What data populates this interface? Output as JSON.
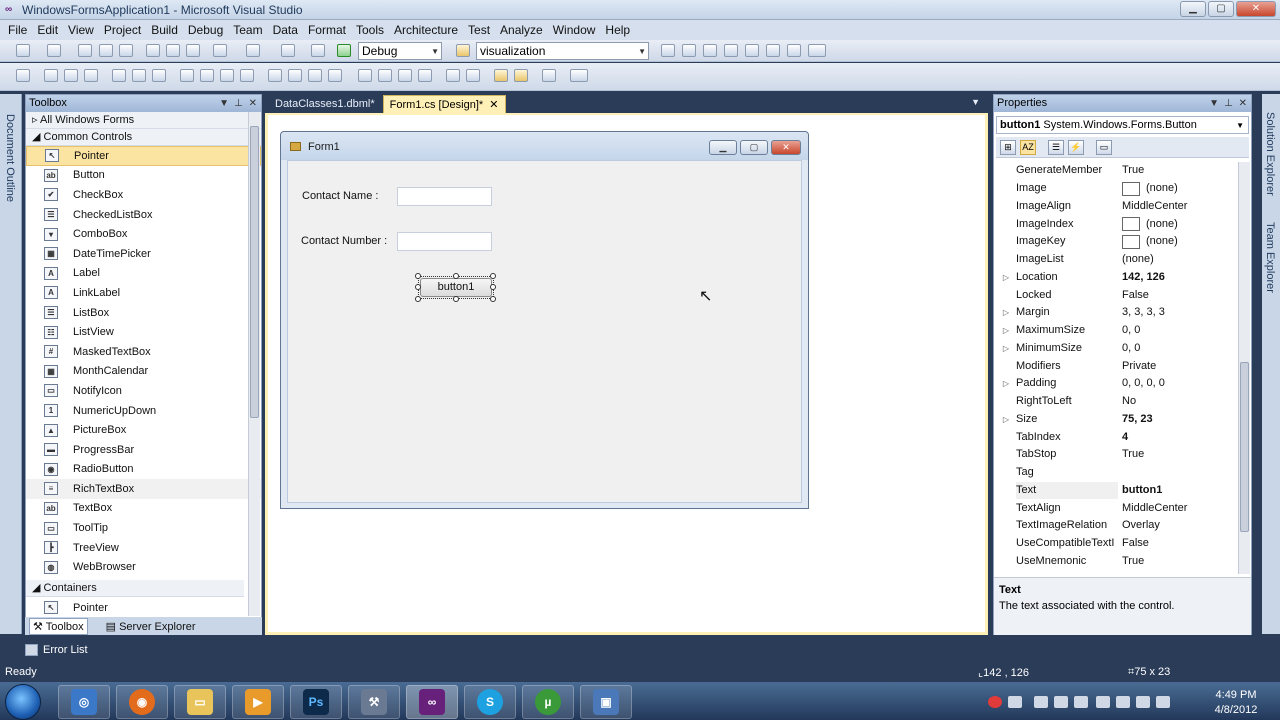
{
  "window": {
    "title": "WindowsFormsApplication1 - Microsoft Visual Studio",
    "vs_icon": "vs-logo-icon"
  },
  "menu": [
    "File",
    "Edit",
    "View",
    "Project",
    "Build",
    "Debug",
    "Team",
    "Data",
    "Format",
    "Tools",
    "Architecture",
    "Test",
    "Analyze",
    "Window",
    "Help"
  ],
  "toolbar": {
    "config": "Debug",
    "find": "visualization"
  },
  "left_strip": {
    "label": "Document Outline"
  },
  "toolbox": {
    "title": "Toolbox",
    "groups": {
      "all": "All Windows Forms",
      "common": "Common Controls",
      "containers": "Containers"
    },
    "items": [
      {
        "label": "Pointer",
        "icon": "pointer-icon",
        "glyph": "↖"
      },
      {
        "label": "Button",
        "icon": "button-icon",
        "glyph": "ab"
      },
      {
        "label": "CheckBox",
        "icon": "checkbox-icon",
        "glyph": "✔"
      },
      {
        "label": "CheckedListBox",
        "icon": "checkedlistbox-icon",
        "glyph": "☰"
      },
      {
        "label": "ComboBox",
        "icon": "combobox-icon",
        "glyph": "▾"
      },
      {
        "label": "DateTimePicker",
        "icon": "datetimepicker-icon",
        "glyph": "▦"
      },
      {
        "label": "Label",
        "icon": "label-icon",
        "glyph": "A"
      },
      {
        "label": "LinkLabel",
        "icon": "linklabel-icon",
        "glyph": "A"
      },
      {
        "label": "ListBox",
        "icon": "listbox-icon",
        "glyph": "☰"
      },
      {
        "label": "ListView",
        "icon": "listview-icon",
        "glyph": "☷"
      },
      {
        "label": "MaskedTextBox",
        "icon": "maskedtextbox-icon",
        "glyph": "#"
      },
      {
        "label": "MonthCalendar",
        "icon": "monthcalendar-icon",
        "glyph": "▦"
      },
      {
        "label": "NotifyIcon",
        "icon": "notifyicon-icon",
        "glyph": "▭"
      },
      {
        "label": "NumericUpDown",
        "icon": "numericupdown-icon",
        "glyph": "1"
      },
      {
        "label": "PictureBox",
        "icon": "picturebox-icon",
        "glyph": "▲"
      },
      {
        "label": "ProgressBar",
        "icon": "progressbar-icon",
        "glyph": "▬"
      },
      {
        "label": "RadioButton",
        "icon": "radiobutton-icon",
        "glyph": "◉"
      },
      {
        "label": "RichTextBox",
        "icon": "richtextbox-icon",
        "glyph": "≡"
      },
      {
        "label": "TextBox",
        "icon": "textbox-icon",
        "glyph": "ab"
      },
      {
        "label": "ToolTip",
        "icon": "tooltip-icon",
        "glyph": "▭"
      },
      {
        "label": "TreeView",
        "icon": "treeview-icon",
        "glyph": "┣"
      },
      {
        "label": "WebBrowser",
        "icon": "webbrowser-icon",
        "glyph": "◍"
      }
    ],
    "containers_first": "Pointer",
    "tabs": {
      "toolbox": "Toolbox",
      "server": "Server Explorer"
    }
  },
  "doc_tabs": {
    "tab1": "DataClasses1.dbml*",
    "tab2": "Form1.cs [Design]*"
  },
  "form": {
    "title": "Form1",
    "label1": "Contact Name :",
    "label2": "Contact Number :",
    "button": "button1"
  },
  "properties": {
    "title": "Properties",
    "object_name": "button1",
    "object_type": "System.Windows.Forms.Button",
    "rows": [
      {
        "name": "GenerateMember",
        "value": "True"
      },
      {
        "name": "Image",
        "value": "(none)",
        "swatch": true
      },
      {
        "name": "ImageAlign",
        "value": "MiddleCenter"
      },
      {
        "name": "ImageIndex",
        "value": "(none)",
        "swatch": true
      },
      {
        "name": "ImageKey",
        "value": "(none)",
        "swatch": true
      },
      {
        "name": "ImageList",
        "value": "(none)"
      },
      {
        "name": "Location",
        "value": "142, 126",
        "expand": true,
        "bold": true
      },
      {
        "name": "Locked",
        "value": "False"
      },
      {
        "name": "Margin",
        "value": "3, 3, 3, 3",
        "expand": true
      },
      {
        "name": "MaximumSize",
        "value": "0, 0",
        "expand": true
      },
      {
        "name": "MinimumSize",
        "value": "0, 0",
        "expand": true
      },
      {
        "name": "Modifiers",
        "value": "Private"
      },
      {
        "name": "Padding",
        "value": "0, 0, 0, 0",
        "expand": true
      },
      {
        "name": "RightToLeft",
        "value": "No"
      },
      {
        "name": "Size",
        "value": "75, 23",
        "expand": true,
        "bold": true
      },
      {
        "name": "TabIndex",
        "value": "4",
        "bold": true
      },
      {
        "name": "TabStop",
        "value": "True"
      },
      {
        "name": "Tag",
        "value": ""
      },
      {
        "name": "Text",
        "value": "button1",
        "bold": true,
        "selected": true
      },
      {
        "name": "TextAlign",
        "value": "MiddleCenter"
      },
      {
        "name": "TextImageRelation",
        "value": "Overlay"
      },
      {
        "name": "UseCompatibleTextI",
        "value": "False"
      },
      {
        "name": "UseMnemonic",
        "value": "True"
      }
    ],
    "desc_title": "Text",
    "desc_text": "The text associated with the control."
  },
  "right_strip": {
    "solution": "Solution Explorer",
    "team": "Team Explorer"
  },
  "error_list": "Error List",
  "status": {
    "ready": "Ready",
    "position": "142 , 126",
    "size": "75 x 23"
  },
  "taskbar": {
    "ps": "Ps",
    "time": "4:49 PM",
    "date": "4/8/2012"
  },
  "colors": {
    "accent": "#fff0b8",
    "chrome": "#2b3c59",
    "selection": "#fbe3a1"
  }
}
